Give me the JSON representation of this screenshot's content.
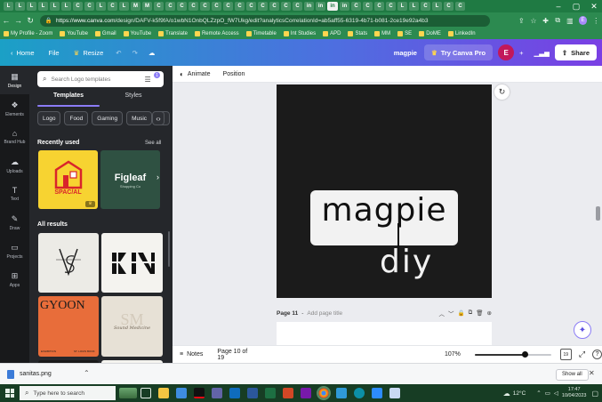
{
  "browser": {
    "tabs": [
      "L",
      "L",
      "L",
      "L",
      "L",
      "L",
      "C",
      "C",
      "L",
      "C",
      "L",
      "M",
      "M",
      "C",
      "C",
      "C",
      "C",
      "C",
      "C",
      "C",
      "C",
      "C",
      "C",
      "C",
      "C",
      "C",
      "in",
      "in",
      "in",
      "in",
      "C",
      "C",
      "C",
      "C",
      "L",
      "L",
      "C",
      "L",
      "C",
      "C"
    ],
    "active_tab_index": 28,
    "url_host": "https://www.canva.com",
    "url_path": "/design/DAFV-k5f9fA/o1wbN1OnbQLZzpO_fW7Ukg/edit?analyticsCorrelationId=ab5aff55-6319-4b71-b081-2ce19e92a4b3",
    "profile_initial": "E",
    "bookmarks": [
      "My Profile - Zoom",
      "YouTube",
      "Gmail",
      "YouTube",
      "Translate",
      "Remote Access",
      "Timetable",
      "Int Studies",
      "APD",
      "Stats",
      "MM",
      "SE",
      "DoME",
      "LinkedIn"
    ]
  },
  "canva_header": {
    "home": "Home",
    "file": "File",
    "resize": "Resize",
    "design_name": "magpie",
    "try_pro": "Try Canva Pro",
    "avatar_initial": "E",
    "share": "Share"
  },
  "rail": [
    {
      "label": "Design",
      "icon": "design-icon"
    },
    {
      "label": "Elements",
      "icon": "elements-icon"
    },
    {
      "label": "Brand Hub",
      "icon": "brand-hub-icon"
    },
    {
      "label": "Uploads",
      "icon": "uploads-icon"
    },
    {
      "label": "Text",
      "icon": "text-icon"
    },
    {
      "label": "Draw",
      "icon": "draw-icon"
    },
    {
      "label": "Projects",
      "icon": "projects-icon"
    },
    {
      "label": "Apps",
      "icon": "apps-icon"
    }
  ],
  "panel": {
    "search_placeholder": "Search Logo templates",
    "filter_count": "1",
    "tab_templates": "Templates",
    "tab_styles": "Styles",
    "chips": [
      "Logo",
      "Food",
      "Gaming",
      "Music",
      "S"
    ],
    "recently_used": "Recently used",
    "see_all": "See all",
    "recent": [
      {
        "name": "SPAC/AL",
        "bg": "#f7d331"
      },
      {
        "name": "Figleaf",
        "sub": "Shopping Co",
        "bg": "#2f5142"
      }
    ],
    "all_results": "All results",
    "results": [
      {
        "text": "V S",
        "bg": "#ecebe6"
      },
      {
        "text": "KN",
        "bg": "#f4f3ef"
      },
      {
        "text": "GYOON",
        "sub_left": "EXHIBITION",
        "sub_right": "ST. LOUIS BOOK",
        "bg": "#e86d3a"
      },
      {
        "text": "SM",
        "sub": "Sound Medicine",
        "bg": "#e7e1d6"
      }
    ]
  },
  "toolbar": {
    "animate": "Animate",
    "position": "Position"
  },
  "design": {
    "word1": "magpie",
    "word2": "diy",
    "background": "#1b1b1b"
  },
  "page_label": {
    "number": "Page 11",
    "separator": "-",
    "placeholder": "Add page title"
  },
  "status": {
    "notes": "Notes",
    "page_count": "Page 10 of 19",
    "zoom": "107%",
    "zoom_fraction": 0.65
  },
  "downloads": {
    "file": "sanitas.png",
    "show_all": "Show all"
  },
  "taskbar": {
    "search": "Type here to search",
    "temperature": "12°C",
    "time": "17:47",
    "date": "10/04/2023"
  },
  "colors": {
    "accent": "#8b7cf6",
    "header_start": "#1ba0c6",
    "header_end": "#7a3fe4",
    "browser_green": "#2c8a50"
  }
}
